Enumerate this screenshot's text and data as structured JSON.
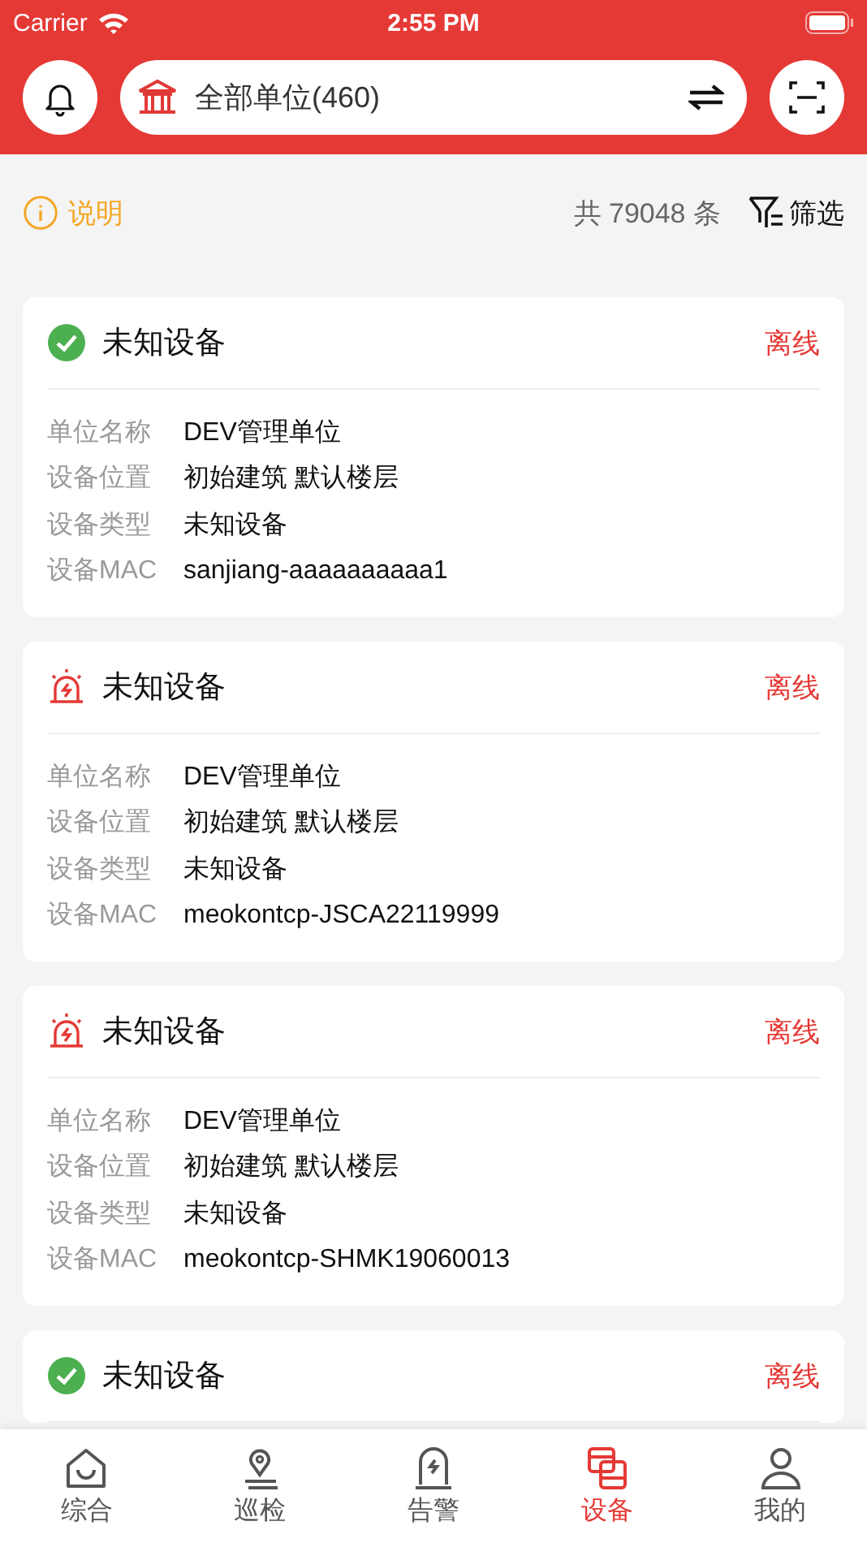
{
  "status_bar": {
    "carrier": "Carrier",
    "time": "2:55 PM"
  },
  "header": {
    "unit_selector": "全部单位(460)"
  },
  "toolbar": {
    "info_link": "说明",
    "total": "共 79048 条",
    "filter": "筛选"
  },
  "devices": [
    {
      "kind": "ok",
      "name": "未知设备",
      "status": "离线",
      "fields": [
        {
          "label": "单位名称",
          "value": "DEV管理单位"
        },
        {
          "label": "设备位置",
          "value": "初始建筑 默认楼层"
        },
        {
          "label": "设备类型",
          "value": "未知设备"
        },
        {
          "label": "设备MAC",
          "value": "sanjiang-aaaaaaaaaa1"
        }
      ]
    },
    {
      "kind": "alarm",
      "name": "未知设备",
      "status": "离线",
      "fields": [
        {
          "label": "单位名称",
          "value": "DEV管理单位"
        },
        {
          "label": "设备位置",
          "value": "初始建筑 默认楼层"
        },
        {
          "label": "设备类型",
          "value": "未知设备"
        },
        {
          "label": "设备MAC",
          "value": "meokontcp-JSCA22119999"
        }
      ]
    },
    {
      "kind": "alarm",
      "name": "未知设备",
      "status": "离线",
      "fields": [
        {
          "label": "单位名称",
          "value": "DEV管理单位"
        },
        {
          "label": "设备位置",
          "value": "初始建筑 默认楼层"
        },
        {
          "label": "设备类型",
          "value": "未知设备"
        },
        {
          "label": "设备MAC",
          "value": "meokontcp-SHMK19060013"
        }
      ]
    },
    {
      "kind": "ok",
      "name": "未知设备",
      "status": "离线"
    }
  ],
  "tab_bar": [
    {
      "kind": "home",
      "label": "综合",
      "selected": false
    },
    {
      "kind": "patrol",
      "label": "巡检",
      "selected": false
    },
    {
      "kind": "alarm",
      "label": "告警",
      "selected": false
    },
    {
      "kind": "device",
      "label": "设备",
      "selected": true
    },
    {
      "kind": "user",
      "label": "我的",
      "selected": false
    }
  ]
}
